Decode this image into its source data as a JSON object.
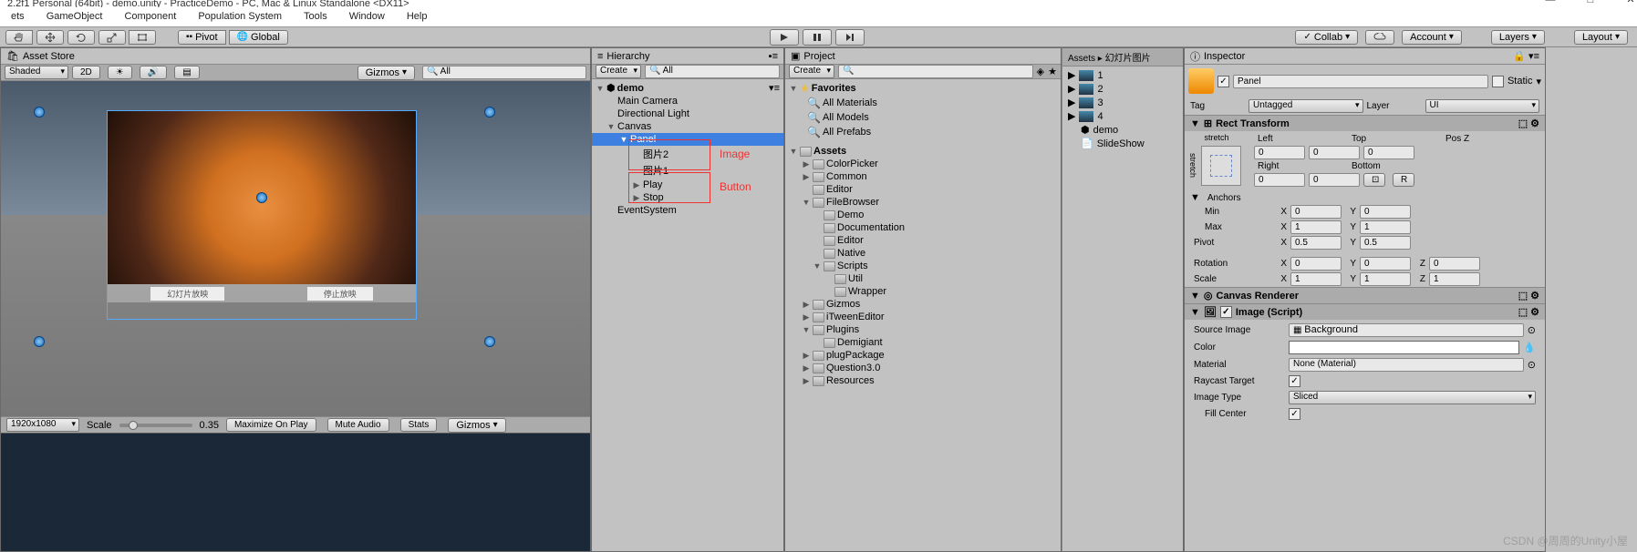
{
  "title": "2.2f1 Personal (64bit) - demo.unity - PracticeDemo - PC, Mac & Linux Standalone <DX11>",
  "menu": [
    "ets",
    "GameObject",
    "Component",
    "Population System",
    "Tools",
    "Window",
    "Help"
  ],
  "toolbar": {
    "pivot": "Pivot",
    "global": "Global",
    "collab": "Collab",
    "account": "Account",
    "layers": "Layers",
    "layout": "Layout"
  },
  "scene": {
    "tab": "Asset Store",
    "shaded": "Shaded",
    "two_d": "2D",
    "gizmos": "Gizmos",
    "search_placeholder": "All",
    "btn1": "幻灯片放映",
    "btn2": "停止放映",
    "resolution": "1920x1080",
    "scale_label": "Scale",
    "scale_val": "0.35",
    "maximize": "Maximize On Play",
    "mute": "Mute Audio",
    "stats": "Stats",
    "giz2": "Gizmos"
  },
  "hierarchy": {
    "tab": "Hierarchy",
    "create": "Create",
    "search_placeholder": "All",
    "scene": "demo",
    "items": {
      "main_camera": "Main Camera",
      "dir_light": "Directional Light",
      "canvas": "Canvas",
      "panel": "Panel",
      "img2": "图片2",
      "img1": "图片1",
      "play": "Play",
      "stop": "Stop",
      "event_system": "EventSystem"
    },
    "annot_image": "Image",
    "annot_button": "Button"
  },
  "project": {
    "tab": "Project",
    "create": "Create",
    "favorites": "Favorites",
    "fav_items": [
      "All Materials",
      "All Models",
      "All Prefabs"
    ],
    "assets": "Assets",
    "folders": [
      "ColorPicker",
      "Common",
      "Editor",
      "FileBrowser"
    ],
    "sub_folders": [
      "Demo",
      "Documentation",
      "Editor",
      "Native",
      "Scripts"
    ],
    "script_sub": [
      "Util",
      "Wrapper"
    ],
    "folders2": [
      "Gizmos",
      "iTweenEditor",
      "Plugins"
    ],
    "plugin_sub": [
      "Demigiant"
    ],
    "folders3": [
      "plugPackage",
      "Question3.0",
      "Resources"
    ],
    "breadcrumb": "Assets ▸ 幻灯片图片",
    "assets_list": [
      "1",
      "2",
      "3",
      "4",
      "demo",
      "SlideShow"
    ]
  },
  "inspector": {
    "tab": "Inspector",
    "name": "Panel",
    "static": "Static",
    "tag_label": "Tag",
    "tag": "Untagged",
    "layer_label": "Layer",
    "layer": "UI",
    "rect_transform": "Rect Transform",
    "stretch": "stretch",
    "left": "Left",
    "top": "Top",
    "posz": "Pos Z",
    "right": "Right",
    "bottom": "Bottom",
    "left_v": "0",
    "top_v": "0",
    "posz_v": "0",
    "right_v": "0",
    "bottom_v": "0",
    "anchors": "Anchors",
    "min": "Min",
    "min_x": "0",
    "min_y": "0",
    "max": "Max",
    "max_x": "1",
    "max_y": "1",
    "pivot": "Pivot",
    "pivot_x": "0.5",
    "pivot_y": "0.5",
    "rotation": "Rotation",
    "rot_x": "0",
    "rot_y": "0",
    "rot_z": "0",
    "scale": "Scale",
    "scale_x": "1",
    "scale_y": "1",
    "scale_z": "1",
    "canvas_renderer": "Canvas Renderer",
    "image_script": "Image (Script)",
    "source_image": "Source Image",
    "source_image_v": "Background",
    "color": "Color",
    "material": "Material",
    "material_v": "None (Material)",
    "raycast": "Raycast Target",
    "image_type": "Image Type",
    "image_type_v": "Sliced",
    "fill_center": "Fill Center"
  },
  "watermark": "CSDN @周周的Unity小屋"
}
